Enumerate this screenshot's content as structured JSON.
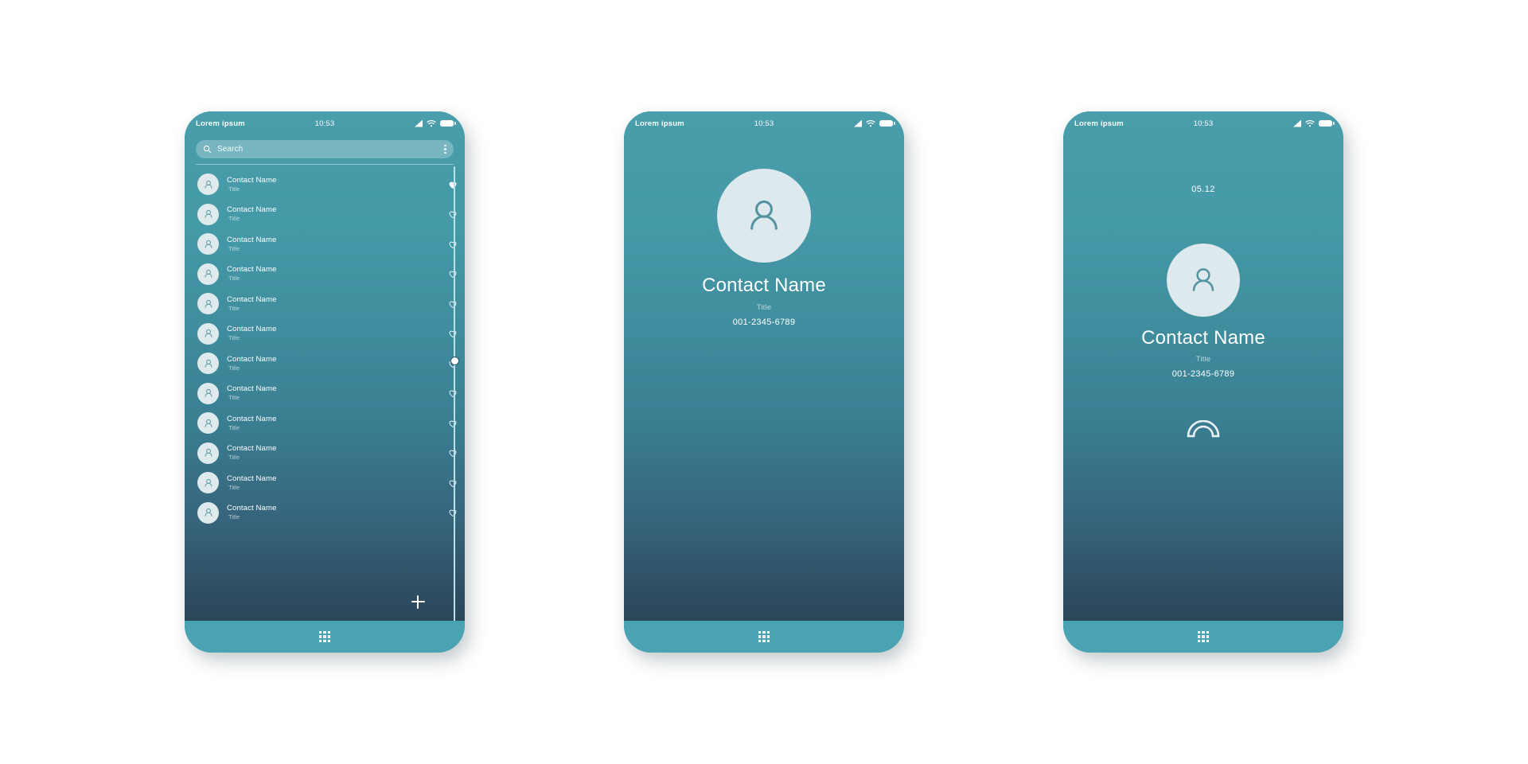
{
  "status": {
    "carrier": "Lorem ipsum",
    "time": "10:53",
    "icons": [
      "signal-icon",
      "wifi-icon",
      "battery-icon"
    ]
  },
  "colors": {
    "screen_top": "#4a9dab",
    "screen_bottom": "#2c4659",
    "navbar": "#4aa3b0",
    "avatar_bg": "#dde9ec",
    "accent_white": "#ffffff",
    "scrollbar": "#b9e2ea"
  },
  "navbar": {
    "icon": "apps-grid-icon"
  },
  "screen1": {
    "name": "contact-list-screen",
    "search": {
      "placeholder": "Search",
      "icon": "search-icon",
      "menu_icon": "kebab-menu-icon"
    },
    "add_button": {
      "icon": "plus-icon",
      "label": "+"
    },
    "scrollbar": {
      "thumb_position_pct": 42
    },
    "contacts": [
      {
        "name": "Contact Name",
        "title": "Title",
        "favorite": true
      },
      {
        "name": "Contact Name",
        "title": "Title",
        "favorite": false
      },
      {
        "name": "Contact Name",
        "title": "Title",
        "favorite": false
      },
      {
        "name": "Contact Name",
        "title": "Title",
        "favorite": false
      },
      {
        "name": "Contact Name",
        "title": "Title",
        "favorite": false
      },
      {
        "name": "Contact Name",
        "title": "Title",
        "favorite": false
      },
      {
        "name": "Contact Name",
        "title": "Title",
        "favorite": false
      },
      {
        "name": "Contact Name",
        "title": "Title",
        "favorite": false
      },
      {
        "name": "Contact Name",
        "title": "Title",
        "favorite": false
      },
      {
        "name": "Contact Name",
        "title": "Title",
        "favorite": false
      },
      {
        "name": "Contact Name",
        "title": "Title",
        "favorite": false
      },
      {
        "name": "Contact Name",
        "title": "Title",
        "favorite": false
      }
    ]
  },
  "screen2": {
    "name": "contact-detail-screen",
    "avatar_icon": "person-icon",
    "contact_name": "Contact Name",
    "contact_title": "Title",
    "phone_number": "001-2345-6789"
  },
  "screen3": {
    "name": "active-call-screen",
    "call_duration": "05.12",
    "avatar_icon": "person-icon",
    "contact_name": "Contact Name",
    "contact_title": "Title",
    "phone_number": "001-2345-6789",
    "end_call": {
      "icon": "end-call-icon"
    }
  }
}
